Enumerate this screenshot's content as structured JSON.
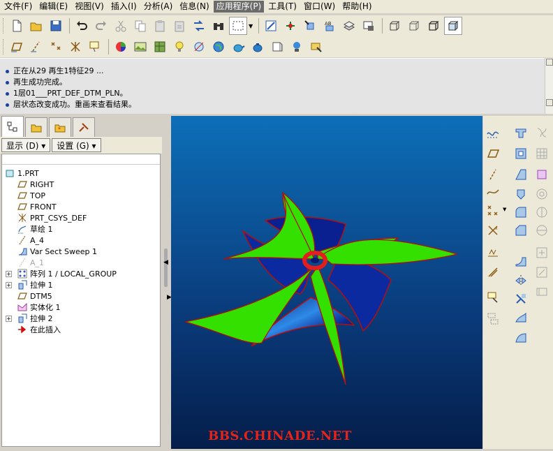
{
  "menu": [
    {
      "label": "文件(F)",
      "active": false
    },
    {
      "label": "编辑(E)",
      "active": false
    },
    {
      "label": "视图(V)",
      "active": false
    },
    {
      "label": "插入(I)",
      "active": false
    },
    {
      "label": "分析(A)",
      "active": false
    },
    {
      "label": "信息(N)",
      "active": false
    },
    {
      "label": "应用程序(P)",
      "active": true
    },
    {
      "label": "工具(T)",
      "active": false
    },
    {
      "label": "窗口(W)",
      "active": false
    },
    {
      "label": "帮助(H)",
      "active": false
    }
  ],
  "messages": [
    "正在从29 再生1特征29 ...",
    "再生成功完成。",
    "1层01___PRT_DEF_DTM_PLN。",
    "层状态改变成功。重画来查看结果。"
  ],
  "nav": {
    "show_label": "显示 (D) ▾",
    "settings_label": "设置 (G) ▾"
  },
  "tree": [
    {
      "label": "1.PRT",
      "icon": "part-icon",
      "expand": false,
      "indent": 0
    },
    {
      "label": "RIGHT",
      "icon": "datum-plane-icon",
      "expand": false,
      "indent": 1
    },
    {
      "label": "TOP",
      "icon": "datum-plane-icon",
      "expand": false,
      "indent": 1
    },
    {
      "label": "FRONT",
      "icon": "datum-plane-icon",
      "expand": false,
      "indent": 1
    },
    {
      "label": "PRT_CSYS_DEF",
      "icon": "csys-icon",
      "expand": false,
      "indent": 1
    },
    {
      "label": "草绘 1",
      "icon": "sketch-icon",
      "expand": false,
      "indent": 1
    },
    {
      "label": "A_4",
      "icon": "axis-icon",
      "expand": false,
      "indent": 1
    },
    {
      "label": "Var Sect Sweep 1",
      "icon": "sweep-icon",
      "expand": false,
      "indent": 1
    },
    {
      "label": "A_1",
      "icon": "axis-icon",
      "expand": false,
      "indent": 1,
      "faded": true
    },
    {
      "label": "阵列 1 / LOCAL_GROUP",
      "icon": "pattern-icon",
      "expand": true,
      "indent": 1
    },
    {
      "label": "拉伸 1",
      "icon": "extrude-icon",
      "expand": true,
      "indent": 1
    },
    {
      "label": "DTM5",
      "icon": "datum-plane-icon",
      "expand": false,
      "indent": 1
    },
    {
      "label": "实体化 1",
      "icon": "solidify-icon",
      "expand": false,
      "indent": 1
    },
    {
      "label": "拉伸 2",
      "icon": "extrude-icon",
      "expand": true,
      "indent": 1
    },
    {
      "label": "在此插入",
      "icon": "insert-arrow-icon",
      "expand": false,
      "indent": 1
    }
  ],
  "watermark": "BBS.CHINADE.NET",
  "colors": {
    "blade": "#33e000",
    "edge": "#b01010",
    "hub": "#e41e1e",
    "body": "#1040b0"
  }
}
